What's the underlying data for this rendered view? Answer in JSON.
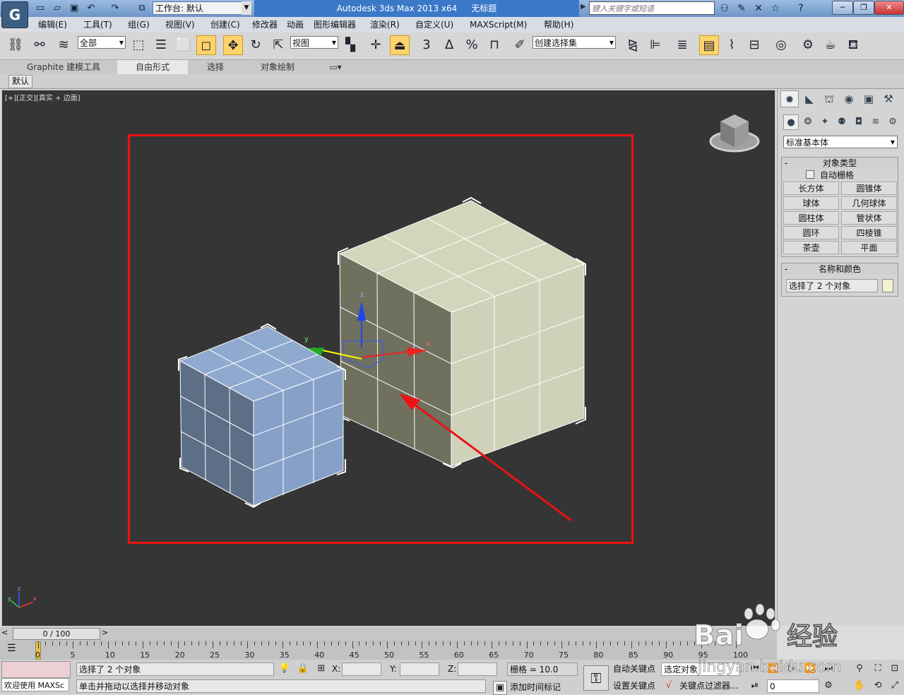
{
  "title": {
    "logo": "G",
    "workspace_label": "工作台: 默认",
    "app": "Autodesk 3ds Max  2013 x64",
    "document": "无标题",
    "search_placeholder": "键入关键字或短语"
  },
  "menu": [
    "编辑(E)",
    "工具(T)",
    "组(G)",
    "视图(V)",
    "创建(C)",
    "修改器",
    "动画",
    "图形编辑器",
    "渲染(R)",
    "自定义(U)",
    "MAXScript(M)",
    "帮助(H)"
  ],
  "toolbar": {
    "selection_filter": "全部",
    "ref_coord": "视图",
    "named_selection": "创建选择集",
    "snap_3": "3",
    "snap_angle": "∆",
    "snap_percent": "%"
  },
  "ribbon": {
    "tabs": [
      "Graphite 建模工具",
      "自由形式",
      "选择",
      "对象绘制"
    ],
    "active_tab": "自由形式",
    "sub_tag": "默认"
  },
  "viewport": {
    "label": "[+][正交][真实 + 边面]",
    "gizmo_x": "x",
    "gizmo_y": "y",
    "gizmo_z": "z",
    "small_cube_color": "#8fa9cf",
    "large_cube_color": "#d8dcc0",
    "highlight_color": "#ee1111"
  },
  "command_panel": {
    "category": "标准基本体",
    "object_type_header": "对象类型",
    "autogrid_label": "自动栅格",
    "primitives": [
      "长方体",
      "圆锥体",
      "球体",
      "几何球体",
      "圆柱体",
      "管状体",
      "圆环",
      "四棱锥",
      "茶壶",
      "平面"
    ],
    "name_color_header": "名称和颜色",
    "name_field": "选择了 2 个对象",
    "swatch_color": "#f2f2d0"
  },
  "timeline": {
    "slider_label": "0 / 100",
    "ticks": [
      0,
      5,
      10,
      15,
      20,
      25,
      30,
      35,
      40,
      45,
      50,
      55,
      60,
      65,
      70,
      75,
      80,
      85,
      90,
      95,
      100
    ]
  },
  "status": {
    "maxscript_label": "欢迎使用 MAXSc",
    "selection_info": "选择了 2 个对象",
    "prompt": "单击并拖动以选择并移动对象",
    "x_label": "X:",
    "y_label": "Y:",
    "z_label": "Z:",
    "grid": "栅格 = 10.0",
    "add_time_tag": "添加时间标记",
    "auto_key": "自动关键点",
    "set_key": "设置关键点",
    "key_mode_dd": "选定对象",
    "key_filters": "关键点过滤器...",
    "frame": "0"
  },
  "watermark": {
    "brand": "Bai",
    "brand2": "经验",
    "url": "jingyan.baidu.com"
  }
}
